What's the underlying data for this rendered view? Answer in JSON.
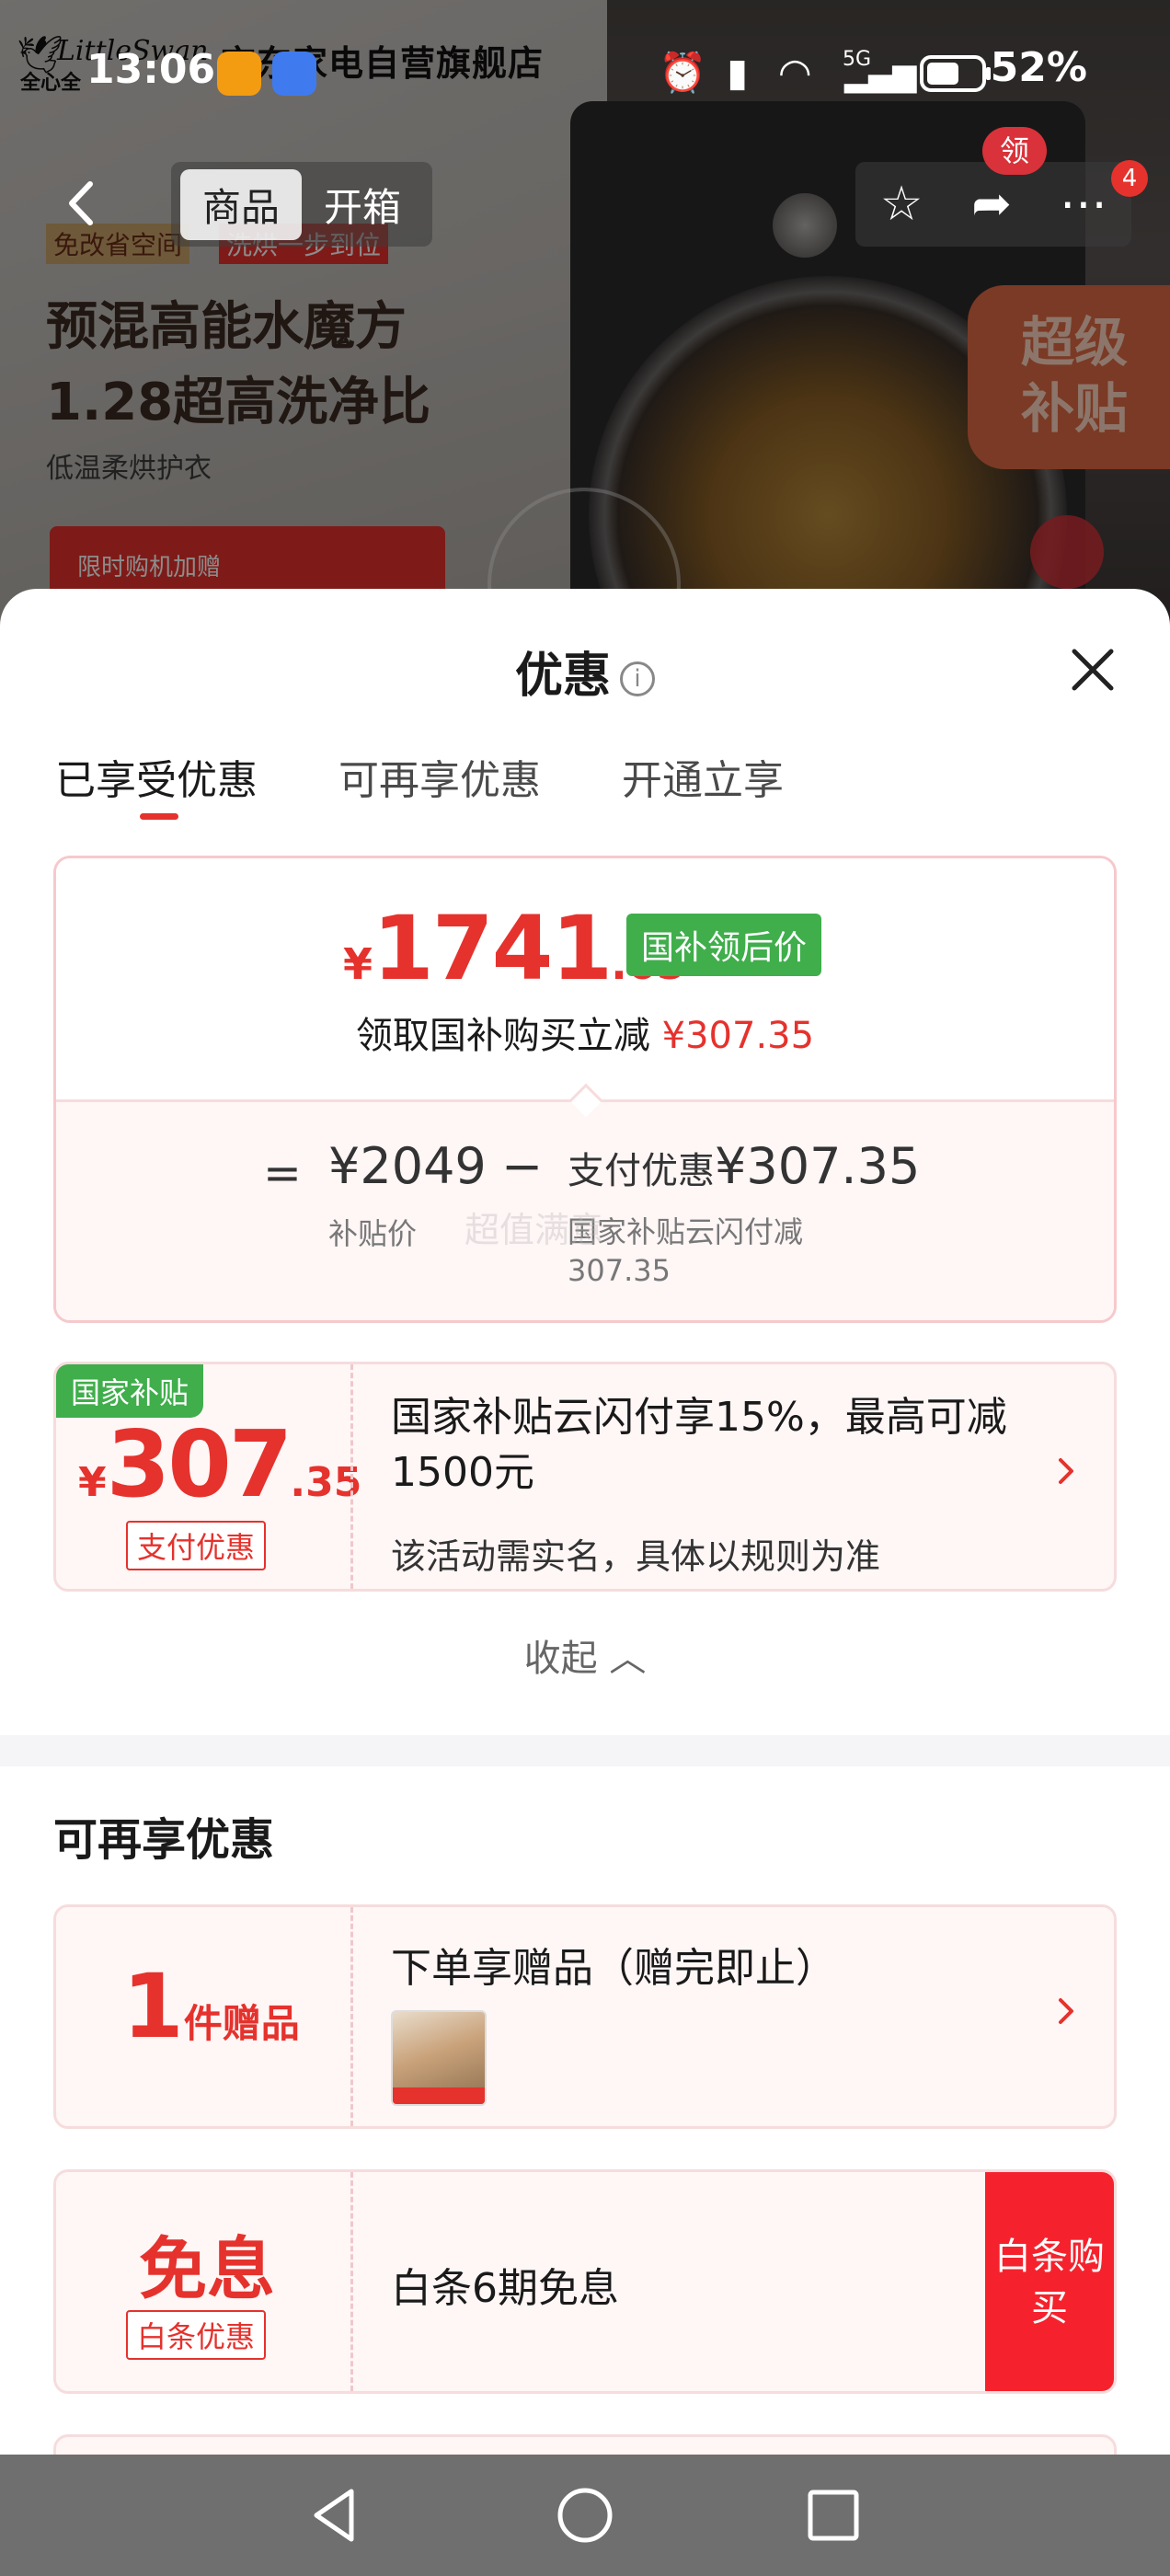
{
  "background": {
    "brand_wordmark": "LittleSwan",
    "brand_cn": "全心全",
    "store_name": "京东家电自营旗舰店",
    "tag1": "免改省空间",
    "tag2": "洗烘一步到位",
    "headline_1": "预混高能水魔方",
    "headline_2": "1.28超高洗净比",
    "subline": "低温柔烘护衣",
    "promo_label": "限时购机加赠",
    "super_badge": "超级补贴"
  },
  "status_bar": {
    "time": "13:06",
    "network": "5G",
    "battery": "52%"
  },
  "top_nav": {
    "back_icon": "chevron-left-icon",
    "tabs": [
      "商品",
      "开箱"
    ],
    "coupon_badge": "领",
    "cart_count": "4"
  },
  "sheet": {
    "title": "优惠",
    "info_glyph": "i",
    "close_glyph": "✕",
    "tabs": [
      "已享受优惠",
      "可再享优惠",
      "开通立享"
    ],
    "price_card": {
      "currency": "¥",
      "price_int": "1741",
      "price_dec": ".65",
      "price_tag": "国补领后价",
      "sub_label": "领取国补购买立减",
      "sub_amount": "¥307.35",
      "eq": "=",
      "base_price": "¥2049",
      "base_label": "补贴价",
      "minus": "−",
      "discount_label": "支付优惠",
      "discount_amount": "¥307.35",
      "discount_desc": "国家补贴云闪付减307.35",
      "watermark": "超值满意"
    },
    "subsidy_coupon": {
      "flag": "国家补贴",
      "currency": "¥",
      "amount_int": "307",
      "amount_dec": ".35",
      "chip": "支付优惠",
      "title": "国家补贴云闪付享15%，最高可减1500元",
      "note": "该活动需实名，具体以规则为准"
    },
    "collapse_label": "收起 ︿",
    "section_title": "可再享优惠",
    "gift_coupon": {
      "count": "1",
      "unit": "件赠品",
      "title": "下单享赠品（赠完即止）"
    },
    "installment_coupon": {
      "headline": "免息",
      "chip": "白条优惠",
      "title": "白条6期免息",
      "button": "白条购买"
    }
  },
  "colors": {
    "accent_red": "#e5322d",
    "subsidy_green": "#3fae4b",
    "card_border": "#f6dcdd",
    "card_bg": "#fff6f6"
  }
}
